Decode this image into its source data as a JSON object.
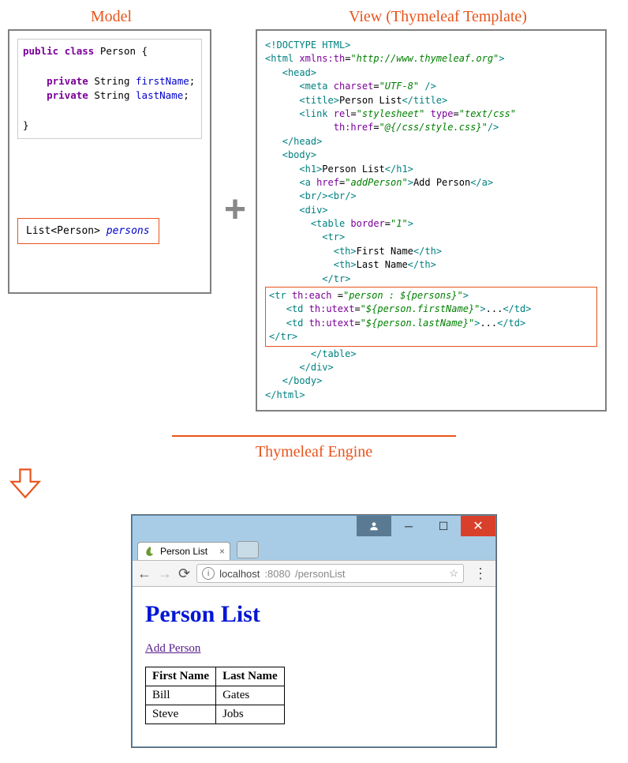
{
  "labels": {
    "model": "Model",
    "view": "View (Thymeleaf Template)",
    "engine": "Thymeleaf Engine"
  },
  "model_code": {
    "line1_kw1": "public",
    "line1_kw2": "class",
    "line1_name": "Person {",
    "line2_kw": "private",
    "line2_type": "String",
    "line2_field": "firstName",
    "line3_kw": "private",
    "line3_type": "String",
    "line3_field": "lastName",
    "close": "}"
  },
  "model_list": {
    "type1": "List",
    "type2": "Person",
    "var": "persons"
  },
  "template": {
    "doctype": "<!DOCTYPE HTML>",
    "html_open": "<html",
    "xmlns_attr": "xmlns:th",
    "xmlns_val": "\"http://www.thymeleaf.org\"",
    "html_close": ">",
    "head_open": "<head>",
    "meta_open": "<meta",
    "meta_attr": "charset",
    "meta_val": "\"UTF-8\"",
    "meta_close": " />",
    "title_open": "<title>",
    "title_text": "Person List",
    "title_close": "</title>",
    "link_open": "<link",
    "link_rel_attr": "rel",
    "link_rel_val": "\"stylesheet\"",
    "link_type_attr": "type",
    "link_type_val": "\"text/css\"",
    "link_href_attr": "th:href",
    "link_href_val": "\"@{/css/style.css}\"",
    "link_close": "/>",
    "head_close": "</head>",
    "body_open": "<body>",
    "h1_open": "<h1>",
    "h1_text": "Person List",
    "h1_close": "</h1>",
    "a_open": "<a",
    "a_href_attr": "href",
    "a_href_val": "\"addPerson\"",
    "a_mid": ">",
    "a_text": "Add Person",
    "a_close": "</a>",
    "br": "<br/><br/>",
    "div_open": "<div>",
    "table_open": "<table",
    "table_attr": "border",
    "table_val": "\"1\"",
    "table_mid": ">",
    "tr_open": "<tr>",
    "th_open": "<th>",
    "th1_text": "First Name",
    "th_close": "</th>",
    "th2_text": "Last Name",
    "tr_close": "</tr>",
    "loop_tr_open": "<tr",
    "loop_each_attr": "th:each",
    "loop_each_eq": " =",
    "loop_each_val": "\"person : ${persons}\"",
    "loop_tr_mid": ">",
    "td_open": "<td",
    "td_attr": "th:utext",
    "td1_val": "\"${person.firstName}\"",
    "td_mid": ">",
    "td_dots": "...",
    "td_close": "</td>",
    "td2_val": "\"${person.lastName}\"",
    "loop_tr_close": "</tr>",
    "table_close": "</table>",
    "div_close": "</div>",
    "body_close": "</body>",
    "html_end": "</html>"
  },
  "browser": {
    "tab_title": "Person List",
    "url_host": "localhost",
    "url_port": ":8080",
    "url_path": "/personList",
    "page_h1": "Person List",
    "add_link": "Add Person",
    "col1": "First Name",
    "col2": "Last Name",
    "rows": [
      {
        "first": "Bill",
        "last": "Gates"
      },
      {
        "first": "Steve",
        "last": "Jobs"
      }
    ]
  }
}
